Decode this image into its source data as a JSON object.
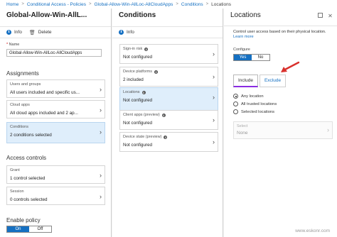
{
  "breadcrumb": {
    "items": [
      "Home",
      "Conditional Access - Policies",
      "Global-Allow-Win-AllLoc-AllCloudApps",
      "Conditions",
      "Locations"
    ],
    "separator": ">"
  },
  "policy_blade": {
    "title": "Global-Allow-Win-AllL...",
    "info_label": "Info",
    "delete_label": "Delete",
    "name_label": "Name",
    "name_value": "Global-Allow-Win-AllLoc-AllCloudApps",
    "assignments_heading": "Assignments",
    "rows": [
      {
        "title": "Users and groups",
        "value": "All users included and specific us..."
      },
      {
        "title": "Cloud apps",
        "value": "All cloud apps included and 2 ap..."
      },
      {
        "title": "Conditions",
        "value": "2 conditions selected"
      }
    ],
    "access_heading": "Access controls",
    "access_rows": [
      {
        "title": "Grant",
        "value": "1 control selected"
      },
      {
        "title": "Session",
        "value": "0 controls selected"
      }
    ],
    "enable_heading": "Enable policy",
    "enable_on": "On",
    "enable_off": "Off"
  },
  "conditions_blade": {
    "title": "Conditions",
    "info_label": "Info",
    "rows": [
      {
        "title": "Sign-in risk",
        "value": "Not configured"
      },
      {
        "title": "Device platforms",
        "value": "2 included"
      },
      {
        "title": "Locations",
        "value": "Not configured"
      },
      {
        "title": "Client apps (preview)",
        "value": "Not configured"
      },
      {
        "title": "Device state (preview)",
        "value": "Not configured"
      }
    ]
  },
  "locations_blade": {
    "title": "Locations",
    "description": "Control user access based on their physical location.",
    "learn_more": "Learn more",
    "configure_label": "Configure",
    "yes_label": "Yes",
    "no_label": "No",
    "tabs": [
      "Include",
      "Exclude"
    ],
    "radio_options": [
      "Any location",
      "All trusted locations",
      "Selected locations"
    ],
    "select_label": "Select",
    "select_value": "None"
  },
  "watermark": "www.eskonr.com",
  "colors": {
    "accent": "#1570c2",
    "selected_row": "#dfeefb",
    "arrow": "#d9302c",
    "active_tab_underline": "#8a2be2"
  }
}
